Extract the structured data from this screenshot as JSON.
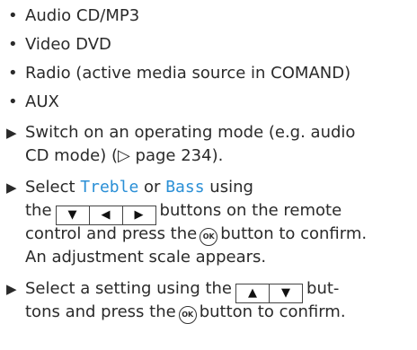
{
  "bullets": [
    "Audio CD/MP3",
    "Video DVD",
    "Radio (active media source in COMAND)",
    "AUX"
  ],
  "bullet_glyph": "•",
  "arrow_glyph": "▶",
  "step1": {
    "line1": "Switch on an operating mode (e.g. audio",
    "line2": "CD mode) (▷ page 234)."
  },
  "step2": {
    "select": "Select",
    "treble": "Treble",
    "or": "or",
    "bass": "Bass",
    "using": "using",
    "the": "the",
    "after_keys": "buttons on the remote",
    "line3": "control and press the",
    "ok_label": "OK",
    "line3_end": "button to confirm.",
    "line4": "An adjustment scale appears."
  },
  "step3": {
    "before_keys": "Select a setting using the",
    "after_keys": "but-",
    "line2_start": "tons and press the",
    "ok_label": "OK",
    "line2_end": "button to confirm."
  },
  "keys": {
    "down": "▼",
    "left": "◀",
    "right": "▶",
    "up": "▲"
  },
  "colors": {
    "highlight": "#2a8fd6",
    "text": "#2a2a2a"
  }
}
